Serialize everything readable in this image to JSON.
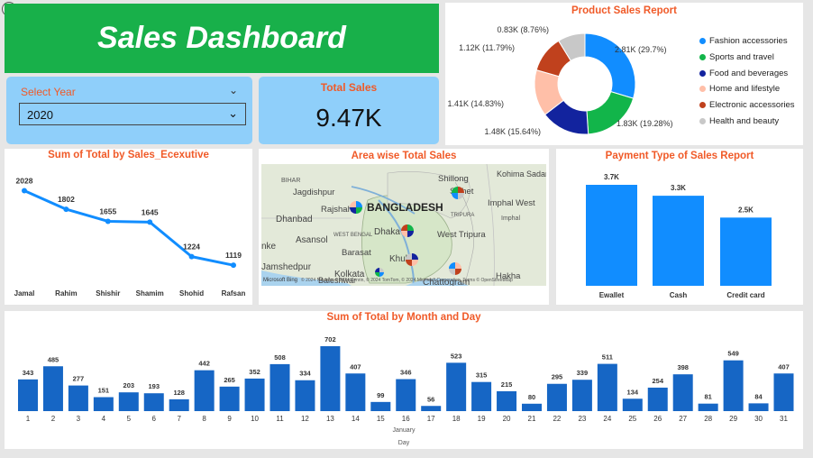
{
  "header": {
    "title": "Sales Dashboard"
  },
  "filter": {
    "label": "Select Year",
    "value": "2020"
  },
  "kpi": {
    "label": "Total Sales",
    "value": "9.47K"
  },
  "product_report": {
    "title": "Product Sales Report",
    "slices": [
      {
        "name": "Fashion accessories",
        "label": "2.81K (29.7%)",
        "value": 2.81,
        "color": "#118dff"
      },
      {
        "name": "Sports and travel",
        "label": "1.83K (19.28%)",
        "value": 1.83,
        "color": "#12b54a"
      },
      {
        "name": "Food and beverages",
        "label": "1.48K (15.64%)",
        "value": 1.48,
        "color": "#12239e"
      },
      {
        "name": "Home and lifestyle",
        "label": "1.41K (14.83%)",
        "value": 1.41,
        "color": "#ffbfa8"
      },
      {
        "name": "Electronic accessories",
        "label": "1.12K (11.79%)",
        "value": 1.12,
        "color": "#c0411d"
      },
      {
        "name": "Health and beauty",
        "label": "0.83K (8.76%)",
        "value": 0.83,
        "color": "#c8c8c8"
      }
    ]
  },
  "executive_report": {
    "title": "Sum of Total by Sales_Ecexutive",
    "categories": [
      "Jamal",
      "Rahim",
      "Shishir",
      "Shamim",
      "Shohid",
      "Rafsan"
    ],
    "values": [
      2028,
      1802,
      1655,
      1645,
      1224,
      1119
    ]
  },
  "area_report": {
    "title": "Area wise Total Sales",
    "country_label": "BANGLADESH",
    "places": [
      "BIHAR",
      "Jagdishpur",
      "Rajshahi",
      "Dhanbad",
      "Asansol",
      "WEST BENGAL",
      "Barasat",
      "Jamshedpur",
      "Kolkata",
      "Baleshwar",
      "Dhaka",
      "Khulna",
      "Chattogram",
      "Shillong",
      "Sylhet",
      "Kohima Sadar",
      "Imphal West",
      "West Tripura",
      "Hakha",
      "TRIPURA",
      "nke",
      "Imphal"
    ],
    "copyright": "© 2024 NavInfo, © 2024 Zenrin, © 2024 TomTom, © 2024 Microsoft Corporation, Terms © OpenStreetMap",
    "brand": "Microsoft Bing"
  },
  "payment_report": {
    "title": "Payment Type of Sales Report",
    "categories": [
      "Ewallet",
      "Cash",
      "Credit card"
    ],
    "values": [
      3.7,
      3.3,
      2.5
    ],
    "labels": [
      "3.7K",
      "3.3K",
      "2.5K"
    ]
  },
  "daily_report": {
    "title": "Sum of Total by Month and Day",
    "xlabel_month": "January",
    "xlabel": "Day",
    "days": [
      1,
      2,
      3,
      4,
      5,
      6,
      7,
      8,
      9,
      10,
      11,
      12,
      13,
      14,
      15,
      16,
      17,
      18,
      19,
      20,
      21,
      22,
      23,
      24,
      25,
      26,
      27,
      28,
      29,
      30,
      31
    ],
    "values": [
      343,
      485,
      277,
      151,
      203,
      193,
      128,
      442,
      265,
      352,
      508,
      334,
      702,
      407,
      99,
      346,
      56,
      523,
      315,
      215,
      80,
      295,
      339,
      511,
      134,
      254,
      398,
      81,
      549,
      84,
      407
    ]
  },
  "chart_data": [
    {
      "type": "pie",
      "title": "Product Sales Report",
      "categories": [
        "Fashion accessories",
        "Sports and travel",
        "Food and beverages",
        "Home and lifestyle",
        "Electronic accessories",
        "Health and beauty"
      ],
      "values": [
        2810,
        1830,
        1480,
        1410,
        1120,
        830
      ],
      "legend": "right"
    },
    {
      "type": "line",
      "title": "Sum of Total by Sales_Ecexutive",
      "categories": [
        "Jamal",
        "Rahim",
        "Shishir",
        "Shamim",
        "Shohid",
        "Rafsan"
      ],
      "values": [
        2028,
        1802,
        1655,
        1645,
        1224,
        1119
      ]
    },
    {
      "type": "bar",
      "title": "Payment Type of Sales Report",
      "categories": [
        "Ewallet",
        "Cash",
        "Credit card"
      ],
      "values": [
        3700,
        3300,
        2500
      ]
    },
    {
      "type": "bar",
      "title": "Sum of Total by Month and Day",
      "xlabel": "Day",
      "categories": [
        1,
        2,
        3,
        4,
        5,
        6,
        7,
        8,
        9,
        10,
        11,
        12,
        13,
        14,
        15,
        16,
        17,
        18,
        19,
        20,
        21,
        22,
        23,
        24,
        25,
        26,
        27,
        28,
        29,
        30,
        31
      ],
      "values": [
        343,
        485,
        277,
        151,
        203,
        193,
        128,
        442,
        265,
        352,
        508,
        334,
        702,
        407,
        99,
        346,
        56,
        523,
        315,
        215,
        80,
        295,
        339,
        511,
        134,
        254,
        398,
        81,
        549,
        84,
        407
      ]
    }
  ]
}
